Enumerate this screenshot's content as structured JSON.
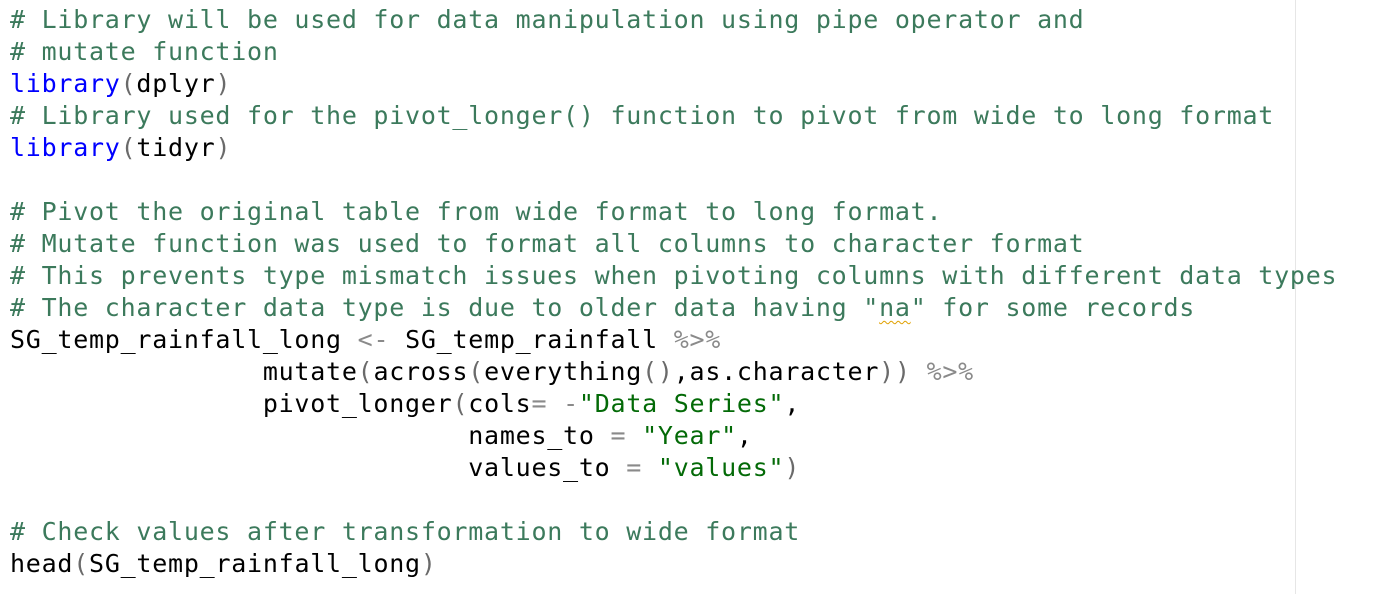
{
  "editor": {
    "lines": [
      {
        "comment": "# Library will be used for data manipulation using pipe operator and"
      },
      {
        "comment": "# mutate function"
      },
      {
        "fn": "library",
        "arg": "dplyr"
      },
      {
        "comment": "# Library used for the pivot_longer() function to pivot from wide to long format"
      },
      {
        "fn": "library",
        "arg": "tidyr"
      },
      {},
      {
        "comment": "# Pivot the original table from wide format to long format."
      },
      {
        "comment": "# Mutate function was used to format all columns to character format"
      },
      {
        "comment": "# This prevents type mismatch issues when pivoting columns with different data types"
      },
      {
        "comment_pre": "# The character data type is due to older data having \"",
        "squiggle_word": "na",
        "comment_post": "\" for some records"
      },
      {
        "lhs": "SG_temp_rainfall_long",
        "assign": "<-",
        "rhs": "SG_temp_rainfall",
        "pipe": "%>%"
      },
      {
        "indent": "                ",
        "fn_outer": "mutate",
        "fn_mid": "across",
        "fn_inner": "everything",
        "sep": ",",
        "arg": "as.character",
        "pipe": "%>%"
      },
      {
        "indent": "                ",
        "fn": "pivot_longer",
        "param": "cols",
        "eq": "=",
        "neg": "-",
        "string": "\"Data Series\"",
        "comma": ","
      },
      {
        "indent": "                             ",
        "param": "names_to",
        "eq": "=",
        "string": "\"Year\"",
        "comma": ","
      },
      {
        "indent": "                             ",
        "param": "values_to",
        "eq": "=",
        "string": "\"values\""
      },
      {},
      {
        "comment": "# Check values after transformation to wide format"
      },
      {
        "fn": "head",
        "arg": "SG_temp_rainfall_long"
      }
    ]
  }
}
